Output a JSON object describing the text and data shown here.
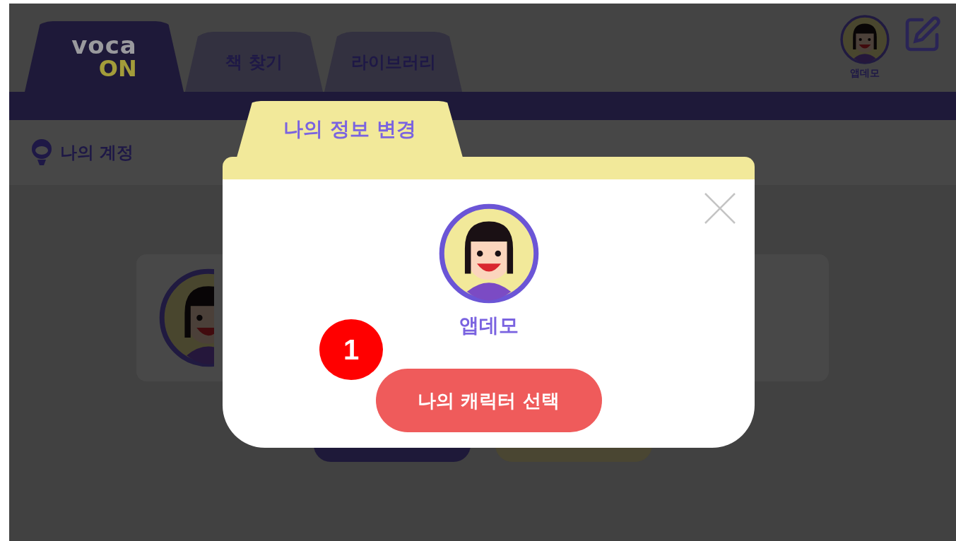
{
  "logo": {
    "top": "voca",
    "bottom": "ON",
    "selected": true
  },
  "tabs": [
    {
      "label": "책 찾기",
      "selected": false
    },
    {
      "label": "라이브러리",
      "selected": false
    }
  ],
  "user": {
    "name": "앱데모"
  },
  "section": {
    "title": "나의 계정"
  },
  "dialog": {
    "tab": "나의 정보 변경",
    "name": "앱데모",
    "button": "나의 캐릭터 선택"
  },
  "step_marker": "1"
}
